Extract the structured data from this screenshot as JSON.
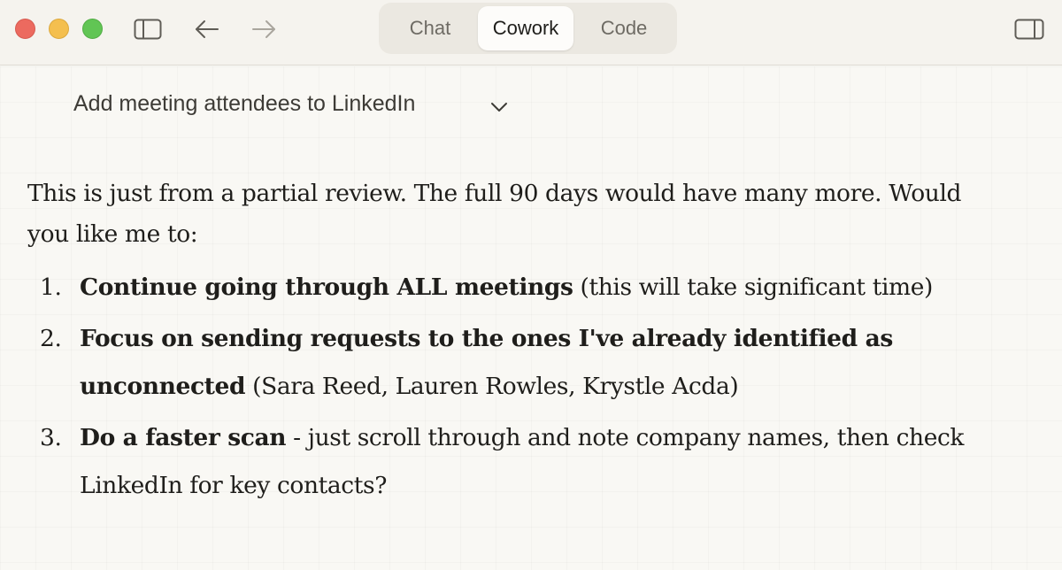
{
  "window": {
    "controls": [
      "close",
      "minimize",
      "maximize"
    ]
  },
  "toolbar": {
    "icons": [
      "sidebar-toggle-icon",
      "back-arrow-icon",
      "forward-arrow-icon",
      "right-panel-icon"
    ]
  },
  "mode_switcher": {
    "tabs": [
      {
        "label": "Chat"
      },
      {
        "label": "Cowork",
        "selected": true
      },
      {
        "label": "Code"
      }
    ]
  },
  "conversation": {
    "title": "Add meeting attendees to LinkedIn"
  },
  "message": {
    "intro": "This is just from a partial review. The full 90 days would have many more. Would you like me to:",
    "options": [
      {
        "number": "1.",
        "bold": "Continue going through ALL meetings",
        "rest": " (this will take significant time)"
      },
      {
        "number": "2.",
        "bold": "Focus on sending requests to the ones I've already identified as unconnected",
        "rest": " (Sara Reed, Lauren Rowles, Krystle Acda)"
      },
      {
        "number": "3.",
        "bold": "Do a faster scan",
        "rest": " - just scroll through and note company names, then check LinkedIn for key contacts?"
      }
    ]
  },
  "colors": {
    "background": "#f9f8f4",
    "titlebar": "#f5f3ee",
    "close": "#ec6a5f",
    "minimize": "#f4bf4f",
    "maximize": "#61c554",
    "selected_tab": "#fdfcfa"
  }
}
